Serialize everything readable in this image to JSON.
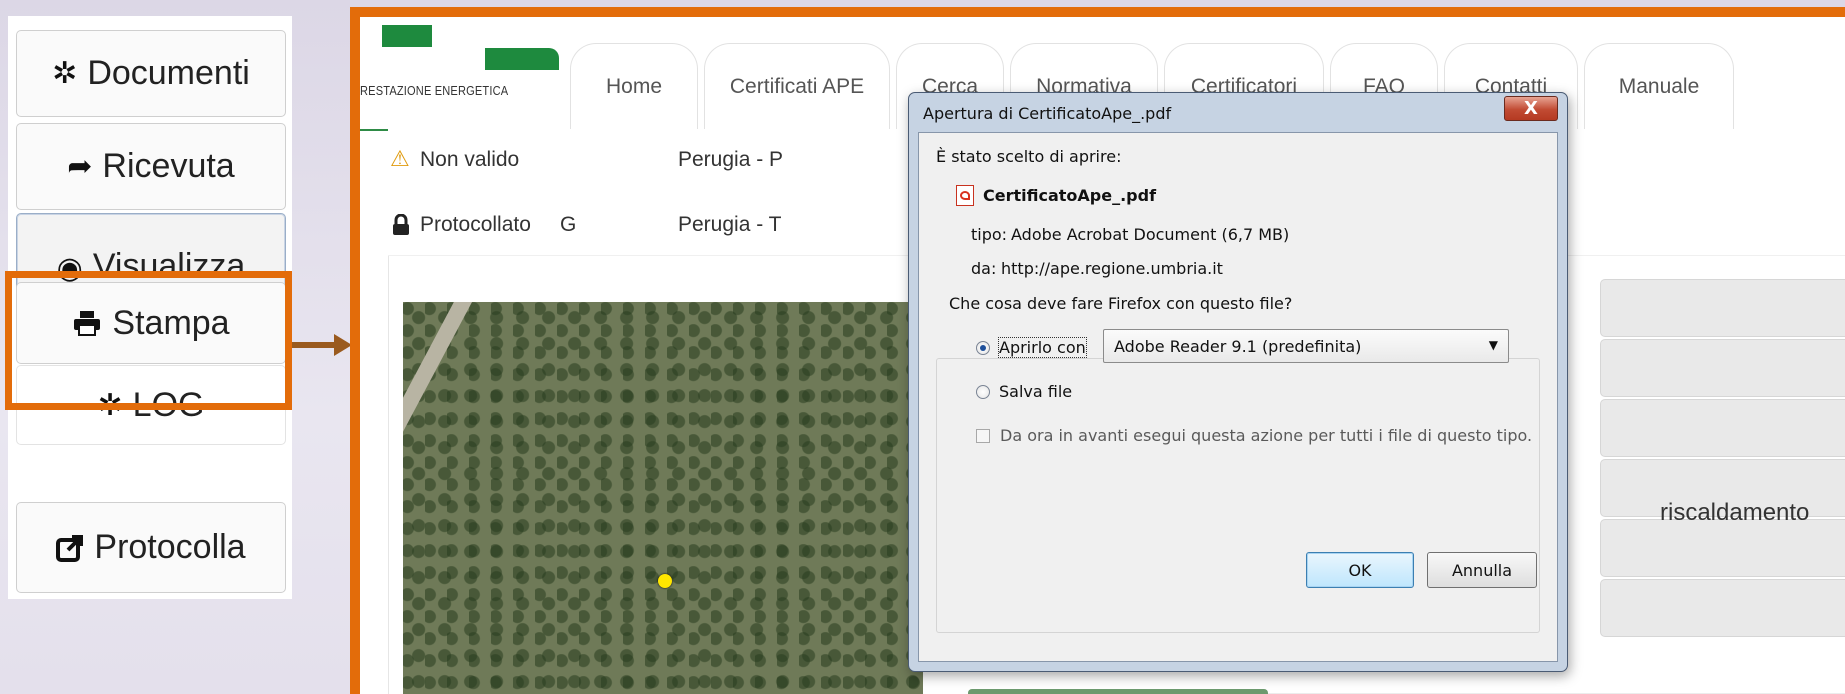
{
  "sidebar": {
    "buttons": [
      {
        "label": "Documenti",
        "icon": "gear-icon"
      },
      {
        "label": "Ricevuta",
        "icon": "share-arrow-icon"
      },
      {
        "label": "Visualizza",
        "icon": "eye-icon"
      },
      {
        "label": "Stampa",
        "icon": "printer-icon"
      },
      {
        "label": "LOG",
        "icon": "gear-icon"
      },
      {
        "label": "Protocolla",
        "icon": "external-link-icon"
      }
    ]
  },
  "header": {
    "logo_text": "RESTAZIONE ENERGETICA",
    "tabs": [
      "Home",
      "Certificati APE",
      "Cerca",
      "Normativa",
      "Certificatori",
      "FAQ",
      "Contatti",
      "Manuale"
    ]
  },
  "rows": [
    {
      "status": "Non valido",
      "code": "",
      "place": "Perugia - P"
    },
    {
      "status": "Protocollato",
      "code": "G",
      "place": "Perugia - T"
    }
  ],
  "right_panel": {
    "partial_label": "riscaldamento"
  },
  "dialog": {
    "title": "Apertura di CertificatoApe_.pdf",
    "close": "X",
    "intro": "È stato scelto di aprire:",
    "filename": "CertificatoApe_.pdf",
    "type_label": "tipo:",
    "type_value": "Adobe Acrobat Document (6,7 MB)",
    "from_label": "da:",
    "from_value": "http://ape.regione.umbria.it",
    "question": "Che cosa deve fare Firefox con questo file?",
    "open_with_label": "Aprirlo con",
    "open_with_value": "Adobe Reader 9.1 (predefinita)",
    "save_label": "Salva file",
    "remember_label": "Da ora in avanti esegui questa azione per tutti i file di questo tipo.",
    "ok": "OK",
    "cancel": "Annulla",
    "selected_option": "open_with"
  },
  "colors": {
    "highlight": "#e36c0a",
    "brand_green": "#1e8a3e"
  }
}
